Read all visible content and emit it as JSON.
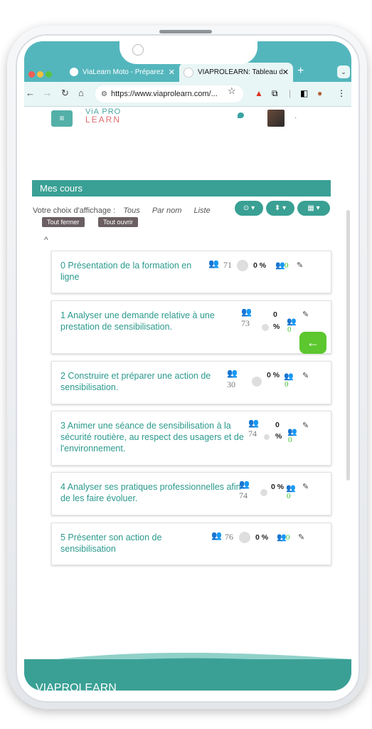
{
  "browser": {
    "tabs": [
      {
        "title": "ViaLearn Moto - Préparez",
        "close": "✕"
      },
      {
        "title": "VIAPROLEARN: Tableau de",
        "close": "✕"
      }
    ],
    "new_tab": "+",
    "tab_menu": "⌄",
    "url": "https://www.viaprolearn.com/...",
    "nav": {
      "back": "←",
      "forward": "→",
      "reload": "↻",
      "home": "⌂"
    },
    "star": "☆"
  },
  "header": {
    "logo_line1": "ViA PRO",
    "logo_line2": "LEARN",
    "menu_icon": "≡",
    "avatar_dot": "·"
  },
  "section": {
    "title": "Mes cours"
  },
  "display": {
    "label": "Votre choix d'affichage :",
    "options": [
      "Tous",
      "Par nom",
      "Liste"
    ],
    "buttons": [
      "⊙ ▾",
      "⬍ ▾",
      "▦ ▾"
    ],
    "collapse_all": "Tout fermer",
    "expand_all": "Tout ouvrir",
    "caret": "^"
  },
  "courses": [
    {
      "title": "0 Présentation de la formation en ligne",
      "users": "71",
      "pct": "0 %",
      "green": "0"
    },
    {
      "title": "1 Analyser une demande relative à une prestation de sensibilisation.",
      "users": "73",
      "pct_num": "0",
      "pct_sym": "%",
      "green": "0"
    },
    {
      "title": "2 Construire et préparer une action de sensibilisation.",
      "users": "30",
      "pct": "0 %",
      "green": "0"
    },
    {
      "title": "3 Animer une séance de sensibilisation à la sécurité routière, au respect des usagers et de l'environnement.",
      "users": "74",
      "pct_num": "0",
      "pct_sym": "%",
      "green": "0"
    },
    {
      "title": "4 Analyser ses pratiques professionnelles afin de les faire évoluer.",
      "users": "74",
      "pct": "0 %",
      "green": "0"
    },
    {
      "title": "5 Présenter son action de sensibilisation",
      "users": "76",
      "pct": "0 %",
      "green": "0"
    }
  ],
  "back_button": "←",
  "footer": {
    "brand": "VIAPROLEARN"
  },
  "colors": {
    "teal": "#3aa095",
    "green": "#3ec02f",
    "tab_bg": "#54b6bd"
  }
}
